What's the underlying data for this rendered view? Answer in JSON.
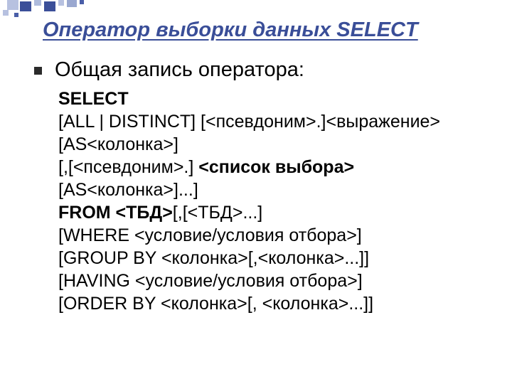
{
  "title": "Оператор выборки данных SELECT",
  "lead": "Общая запись оператора:",
  "code": {
    "l1": "SELECT",
    "l2": "[ALL | DISTINCT] [<псевдоним>.]<выражение>[AS<колонка>]",
    "l3a": "[,[<псевдоним>.] ",
    "l3b": "<список выбора>",
    "l3c": "[AS<колонка>]...]",
    "l4a": "FROM <ТБД>",
    "l4b": "[,[<ТБД>...]",
    "l5": "[WHERE <условие/условия отбора>]",
    "l6": "[GROUP BY <колонка>[,<колонка>...]]",
    "l7": "[HAVING <условие/условия отбора>]",
    "l8": "[ORDER BY <колонка>[, <колонка>...]]"
  }
}
